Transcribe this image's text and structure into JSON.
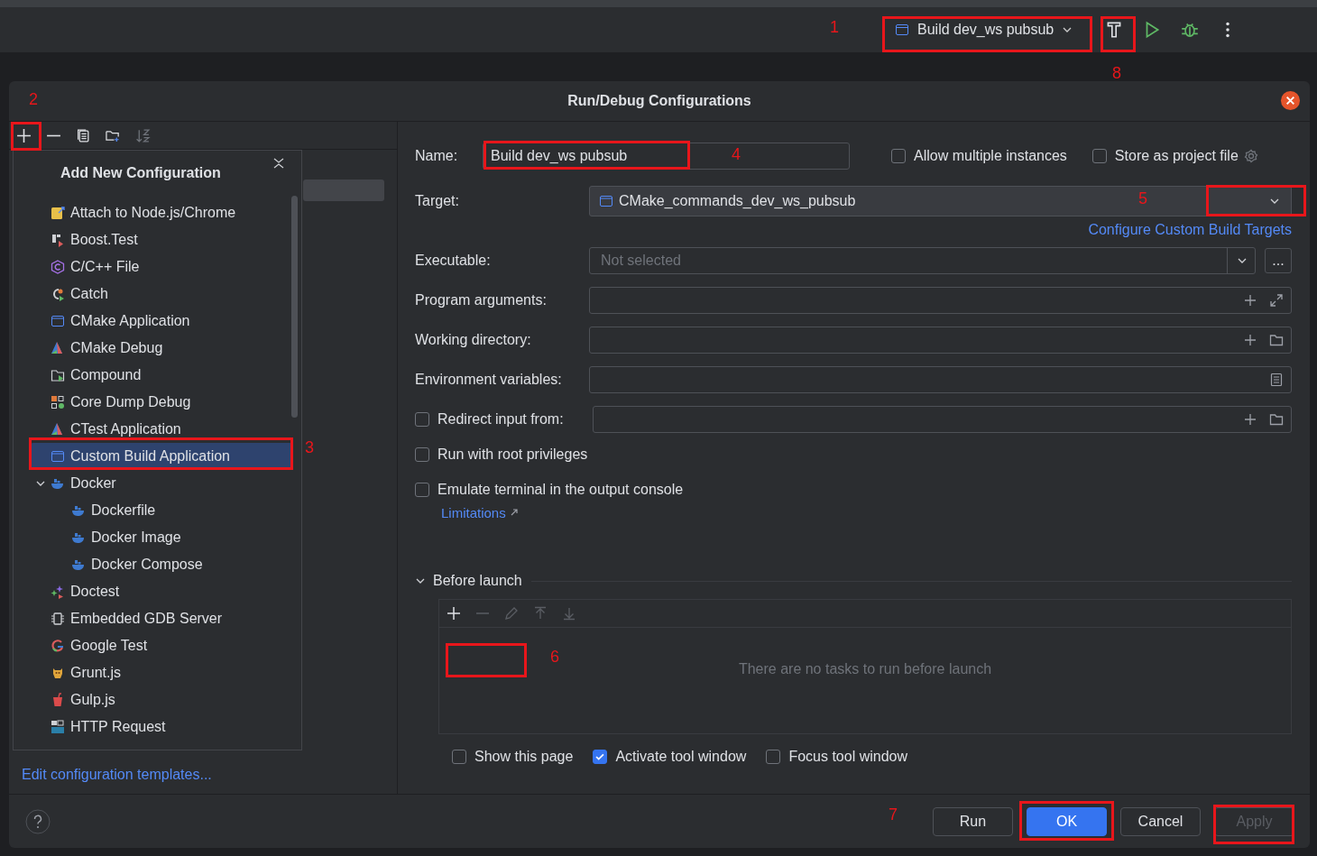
{
  "toolbar": {
    "run_configuration": "Build dev_ws pubsub"
  },
  "dialog": {
    "title": "Run/Debug Configurations",
    "add_menu": {
      "title": "Add New Configuration",
      "items": [
        {
          "label": "Attach to Node.js/Chrome",
          "selected": false
        },
        {
          "label": "Boost.Test",
          "selected": false
        },
        {
          "label": "C/C++ File",
          "selected": false
        },
        {
          "label": "Catch",
          "selected": false
        },
        {
          "label": "CMake Application",
          "selected": false
        },
        {
          "label": "CMake Debug",
          "selected": false
        },
        {
          "label": "Compound",
          "selected": false
        },
        {
          "label": "Core Dump Debug",
          "selected": false
        },
        {
          "label": "CTest Application",
          "selected": false
        },
        {
          "label": "Custom Build Application",
          "selected": true
        },
        {
          "label": "Docker",
          "selected": false,
          "expanded": true,
          "children": [
            {
              "label": "Dockerfile",
              "selected": false
            },
            {
              "label": "Docker Image",
              "selected": false
            },
            {
              "label": "Docker Compose",
              "selected": false
            }
          ]
        },
        {
          "label": "Doctest",
          "selected": false
        },
        {
          "label": "Embedded GDB Server",
          "selected": false
        },
        {
          "label": "Google Test",
          "selected": false
        },
        {
          "label": "Grunt.js",
          "selected": false
        },
        {
          "label": "Gulp.js",
          "selected": false
        },
        {
          "label": "HTTP Request",
          "selected": false
        }
      ]
    },
    "templates_link": "Edit configuration templates...",
    "form": {
      "name": {
        "label": "Name:",
        "value": "Build dev_ws pubsub"
      },
      "allow_multiple": {
        "label": "Allow multiple instances",
        "checked": false
      },
      "store_project": {
        "label": "Store as project file",
        "checked": false
      },
      "target": {
        "label": "Target:",
        "value": "CMake_commands_dev_ws_pubsub"
      },
      "configure_link": "Configure Custom Build Targets",
      "executable": {
        "label": "Executable:",
        "placeholder": "Not selected"
      },
      "browse_button": "...",
      "fields": [
        {
          "label": "Program arguments:",
          "kind": "args"
        },
        {
          "label": "Working directory:",
          "kind": "dir"
        },
        {
          "label": "Environment variables:",
          "kind": "env"
        }
      ],
      "redirect": {
        "label": "Redirect input from:",
        "checked": false
      },
      "options": [
        {
          "label": "Run with root privileges",
          "checked": false
        },
        {
          "label": "Emulate terminal in the output console",
          "checked": false
        }
      ],
      "limitations_link": "Limitations",
      "before_launch": {
        "title": "Before launch",
        "expanded": true,
        "empty_text": "There are no tasks to run before launch"
      },
      "launch_options": [
        {
          "label": "Show this page",
          "checked": false
        },
        {
          "label": "Activate tool window",
          "checked": true
        },
        {
          "label": "Focus tool window",
          "checked": false
        }
      ]
    },
    "buttons": [
      {
        "label": "Run",
        "kind": "default",
        "disabled": false
      },
      {
        "label": "OK",
        "kind": "primary",
        "disabled": false
      },
      {
        "label": "Cancel",
        "kind": "default",
        "disabled": false
      },
      {
        "label": "Apply",
        "kind": "default",
        "disabled": true
      }
    ]
  },
  "annotations": [
    {
      "label": "1"
    },
    {
      "label": "2"
    },
    {
      "label": "3"
    },
    {
      "label": "4"
    },
    {
      "label": "5"
    },
    {
      "label": "6"
    },
    {
      "label": "7"
    },
    {
      "label": "8"
    }
  ]
}
